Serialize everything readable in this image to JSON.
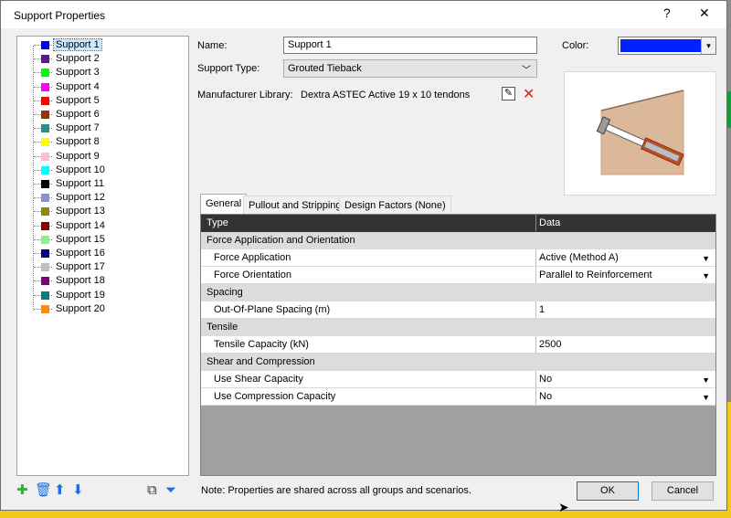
{
  "window": {
    "title": "Support Properties",
    "help": "?",
    "close": "✕"
  },
  "tree": {
    "items": [
      {
        "label": "Support 1",
        "color": "#0000ff"
      },
      {
        "label": "Support 2",
        "color": "#5b1a8c"
      },
      {
        "label": "Support 3",
        "color": "#00ff00"
      },
      {
        "label": "Support 4",
        "color": "#ff00ff"
      },
      {
        "label": "Support 5",
        "color": "#ff0000"
      },
      {
        "label": "Support 6",
        "color": "#a0300a"
      },
      {
        "label": "Support 7",
        "color": "#2a8f8a"
      },
      {
        "label": "Support 8",
        "color": "#ffff00"
      },
      {
        "label": "Support 9",
        "color": "#ffc0cb"
      },
      {
        "label": "Support 10",
        "color": "#00ffff"
      },
      {
        "label": "Support 11",
        "color": "#000000"
      },
      {
        "label": "Support 12",
        "color": "#8f8fd9"
      },
      {
        "label": "Support 13",
        "color": "#8c8c00"
      },
      {
        "label": "Support 14",
        "color": "#8b0000"
      },
      {
        "label": "Support 15",
        "color": "#90ee90"
      },
      {
        "label": "Support 16",
        "color": "#000080"
      },
      {
        "label": "Support 17",
        "color": "#c0c0c0"
      },
      {
        "label": "Support 18",
        "color": "#800080"
      },
      {
        "label": "Support 19",
        "color": "#008080"
      },
      {
        "label": "Support 20",
        "color": "#ff8c00"
      }
    ],
    "selected": "Support 1"
  },
  "form": {
    "name_label": "Name:",
    "name_value": "Support 1",
    "type_label": "Support Type:",
    "type_value": "Grouted Tieback",
    "library_label": "Manufacturer Library:",
    "library_value": "Dextra ASTEC Active 19 x 10 tendons",
    "color_label": "Color:",
    "color_value": "#0022ff"
  },
  "tabs": [
    "General",
    "Pullout and Stripping",
    "Design Factors (None)"
  ],
  "grid": {
    "headers": [
      "Type",
      "Data"
    ],
    "rows": [
      {
        "kind": "group",
        "label": "Force Application and Orientation"
      },
      {
        "kind": "prop",
        "label": "Force Application",
        "value": "Active (Method A)",
        "dropdown": true
      },
      {
        "kind": "prop",
        "label": "Force Orientation",
        "value": "Parallel to Reinforcement",
        "dropdown": true
      },
      {
        "kind": "group",
        "label": "Spacing"
      },
      {
        "kind": "prop",
        "label": "Out-Of-Plane Spacing (m)",
        "value": "1",
        "dropdown": false
      },
      {
        "kind": "group",
        "label": "Tensile"
      },
      {
        "kind": "prop",
        "label": "Tensile Capacity (kN)",
        "value": "2500",
        "dropdown": false
      },
      {
        "kind": "group",
        "label": "Shear and Compression"
      },
      {
        "kind": "prop",
        "label": "Use Shear Capacity",
        "value": "No",
        "dropdown": true
      },
      {
        "kind": "prop",
        "label": "Use Compression Capacity",
        "value": "No",
        "dropdown": true
      }
    ]
  },
  "footer": {
    "note": "Note: Properties are shared across all groups and scenarios.",
    "ok": "OK",
    "cancel": "Cancel"
  }
}
